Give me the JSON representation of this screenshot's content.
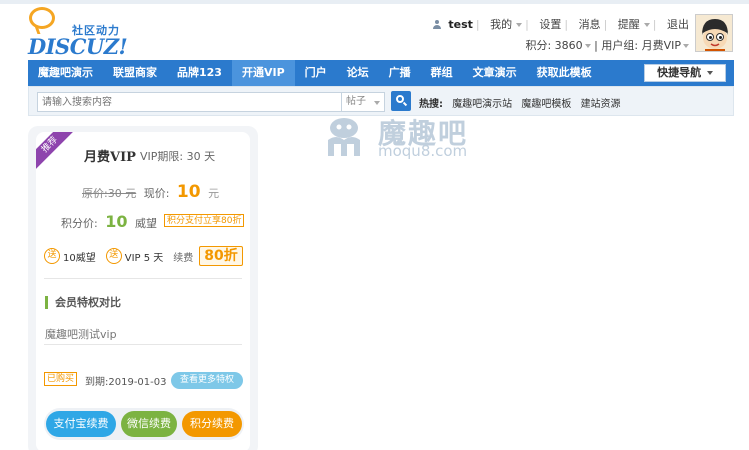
{
  "header": {
    "logo_sub": "社区动力",
    "logo_main": "DISCUZ!",
    "user_name": "test",
    "menu": [
      "我的",
      "设置",
      "消息",
      "提醒",
      "退出"
    ],
    "points_label": "积分: 3860",
    "usergroup_label": "用户组: 月费VIP"
  },
  "nav": {
    "items": [
      "魔趣吧演示",
      "联盟商家",
      "品牌123",
      "开通VIP",
      "门户",
      "论坛",
      "广播",
      "群组",
      "文章演示",
      "获取此模板"
    ],
    "active_index": 3,
    "quick_nav": "快捷导航"
  },
  "search": {
    "placeholder": "请输入搜索内容",
    "type": "帖子",
    "hot_label": "热搜:",
    "hot_links": [
      "魔趣吧演示站",
      "魔趣吧模板",
      "建站资源"
    ]
  },
  "watermark": {
    "title": "魔趣吧",
    "url": "moqu8.com"
  },
  "vip_card": {
    "ribbon": "推荐",
    "plan_name": "月费VIP",
    "period": "VIP期限: 30 天",
    "orig_price": "原价:30 元",
    "now_label": "现价:",
    "now_value": "10",
    "now_unit": "元",
    "points_label": "积分价:",
    "points_value": "10",
    "points_unit": "威望",
    "points_badge": "积分支付立享80折",
    "gift_icon": "送",
    "gift1": "10威望",
    "gift2": "VIP 5 天",
    "renew_label": "续费",
    "discount": "80折",
    "section_title": "会员特权对比",
    "privilege": "魔趣吧测试vip",
    "bought": "已购买",
    "expire": "到期:2019-01-03",
    "more_button": "查看更多特权",
    "pay_alipay": "支付宝续费",
    "pay_wechat": "微信续费",
    "pay_points": "积分续费"
  },
  "colors": {
    "brand_blue": "#2b7acd",
    "accent_orange": "#f39800",
    "accent_green": "#7cb342",
    "ribbon_purple": "#8e44ad"
  }
}
